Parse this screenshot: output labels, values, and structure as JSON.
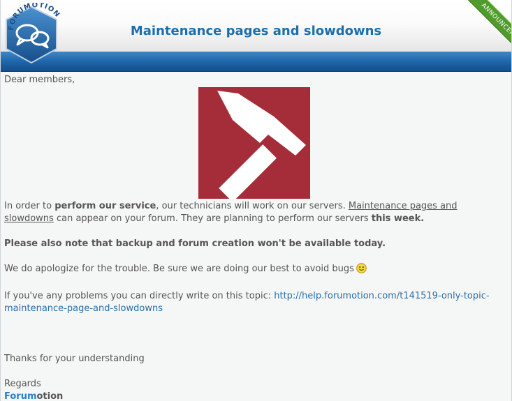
{
  "header": {
    "title": "Maintenance pages and slowdowns",
    "logo_text": "FORUMOTION",
    "ribbon": "ANNOUNCEMENT"
  },
  "colors": {
    "title": "#1d6eac",
    "band": "#1f63a8",
    "ribbon": "#4f9b2b",
    "hammer_bg": "#a52c39",
    "link": "#2a6fa8"
  },
  "body": {
    "greeting": "Dear members,",
    "image_icon": "hammer-icon",
    "p1": {
      "part1": "In order to ",
      "bold1": "perform our service",
      "part2": ", our technicians will work on our servers. ",
      "underline1": "Maintenance pages and slowdowns",
      "part3": " can appear on your forum. They are planning to perform our servers ",
      "bold2": "this week."
    },
    "p2": "Please also note that backup and forum creation won't be available today.",
    "p3": "We do apologize for the trouble. Be sure we are doing our best to avoid bugs",
    "p3_icon": "smiley-icon",
    "p4_text": "If you've any problems you can directly write on this topic: ",
    "p4_link": "http://help.forumotion.com/t141519-only-topic-maintenance-page-and-slowdowns",
    "p5": "Thanks for your understanding",
    "p6": "Regards",
    "sig_a": "Forum",
    "sig_b": "otion"
  }
}
